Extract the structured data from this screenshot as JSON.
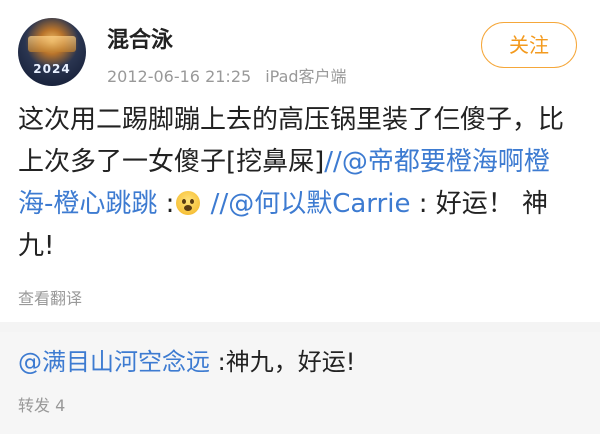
{
  "post": {
    "username": "混合泳",
    "avatar_text": "2024",
    "timestamp": "2012-06-16 21:25",
    "device": "iPad客户端",
    "follow_label": "关注",
    "text_part1": "这次用二踢脚蹦上去的高压锅里装了仨傻子，比上次多了一女傻子[挖鼻屎]",
    "sep1": "//",
    "mention1": "@帝都要橙海啊橙海-橙心跳跳",
    "colon1": " :",
    "sep2": " //",
    "mention2": "@何以默Carrie",
    "text_part2": " : 好运！ 神九!",
    "emoji_name": "fearful-face-emoji",
    "translate_label": "查看翻译"
  },
  "repost": {
    "mention": "@满目山河空念远",
    "text": " :神九，好运!",
    "count_label": "转发 4"
  },
  "colors": {
    "link": "#3d7bd1",
    "follow": "#f39a1e",
    "meta": "#999999"
  }
}
